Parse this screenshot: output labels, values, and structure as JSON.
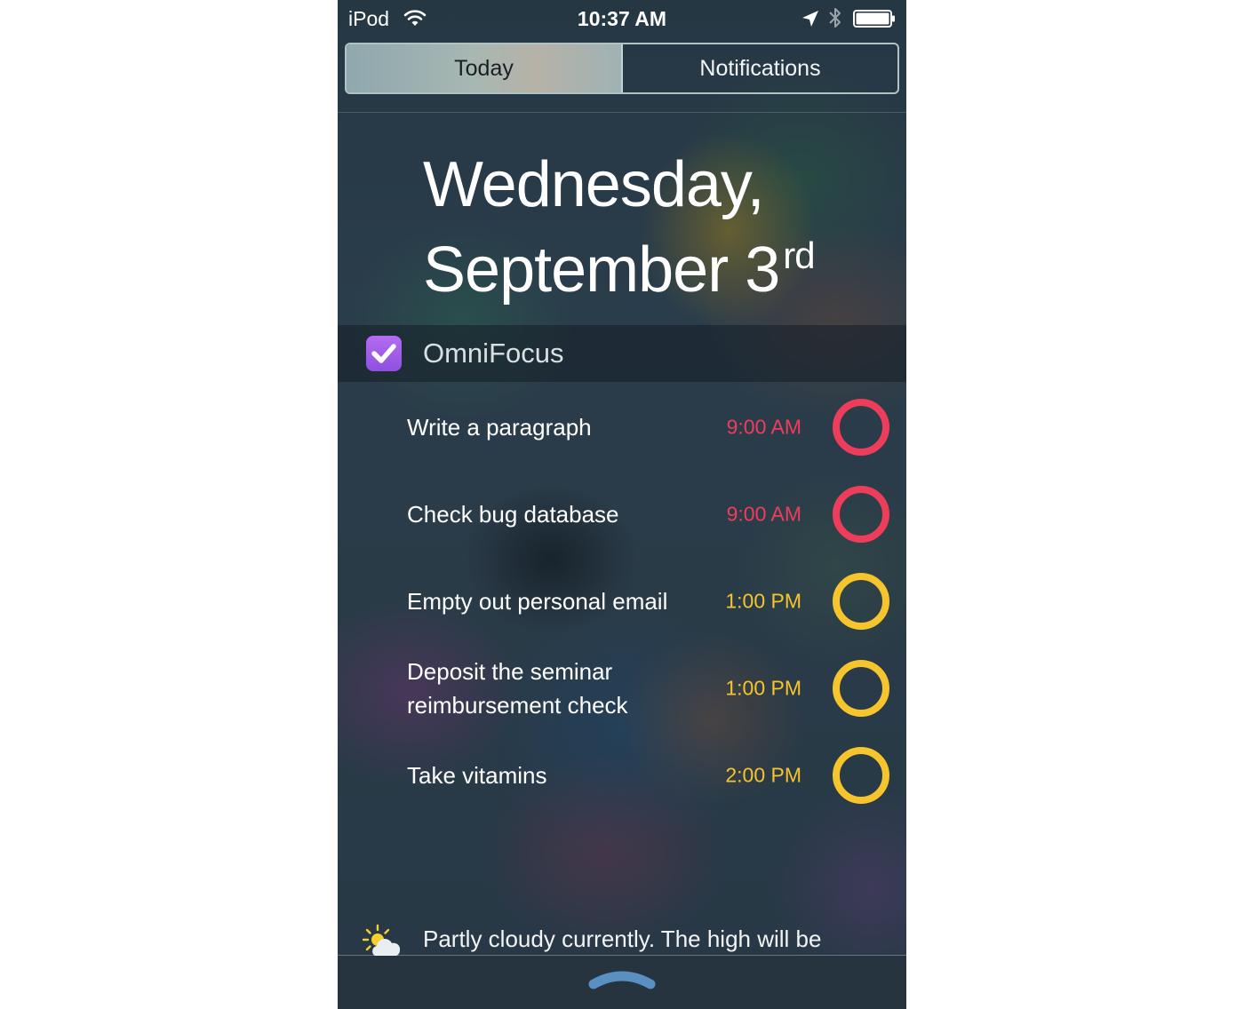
{
  "status_bar": {
    "carrier": "iPod",
    "time": "10:37 AM",
    "icons": [
      "wifi-icon",
      "location-icon",
      "bluetooth-icon",
      "battery-icon"
    ]
  },
  "tabs": [
    {
      "label": "Today",
      "selected": true
    },
    {
      "label": "Notifications",
      "selected": false
    }
  ],
  "date": {
    "line1": "Wednesday,",
    "line2": "September 3",
    "ordinal": "rd"
  },
  "widget": {
    "title": "OmniFocus",
    "icon": "checkmark-icon",
    "icon_color": "#a35ff0"
  },
  "tasks": [
    {
      "title": "Write a paragraph",
      "time": "9:00 AM",
      "status": "overdue",
      "color": "#ee3d5b"
    },
    {
      "title": "Check bug database",
      "time": "9:00 AM",
      "status": "overdue",
      "color": "#ee3d5b"
    },
    {
      "title": "Empty out personal email",
      "time": "1:00 PM",
      "status": "due-soon",
      "color": "#f6c42c"
    },
    {
      "title": "Deposit the seminar reimbursement check",
      "time": "1:00 PM",
      "status": "due-soon",
      "color": "#f6c42c"
    },
    {
      "title": "Take vitamins",
      "time": "2:00 PM",
      "status": "due-soon",
      "color": "#f6c42c"
    }
  ],
  "weather": {
    "icon": "partly-cloudy-icon",
    "text": "Partly cloudy currently. The high will be"
  },
  "grabber": {
    "icon": "grabber-handle-icon"
  }
}
